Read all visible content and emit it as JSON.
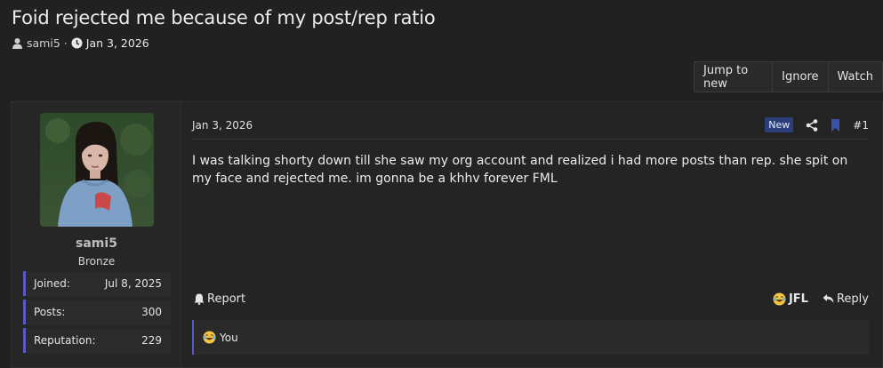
{
  "thread": {
    "title": "Foid rejected me because of my post/rep ratio",
    "author": "sami5",
    "separator": "·",
    "date": "Jan 3, 2026"
  },
  "buttons": {
    "jump_to_new": "Jump to new",
    "ignore": "Ignore",
    "watch": "Watch"
  },
  "user": {
    "name": "sami5",
    "title": "Bronze",
    "stats": [
      {
        "label": "Joined:",
        "value": "Jul 8, 2025"
      },
      {
        "label": "Posts:",
        "value": "300"
      },
      {
        "label": "Reputation:",
        "value": "229"
      }
    ]
  },
  "post": {
    "date": "Jan 3, 2026",
    "badge": "New",
    "number": "#1",
    "body": "I was talking shorty down till she saw my org account and realized i had more posts than rep. she spit on my face and rejected me. im gonna be a khhv forever FML",
    "report_label": "Report",
    "reaction_label": "JFL",
    "reply_label": "Reply",
    "reactions_by": "You"
  },
  "colors": {
    "background": "#212121",
    "accent": "#5b5bc4",
    "badge_bg": "#2c3f7a"
  }
}
